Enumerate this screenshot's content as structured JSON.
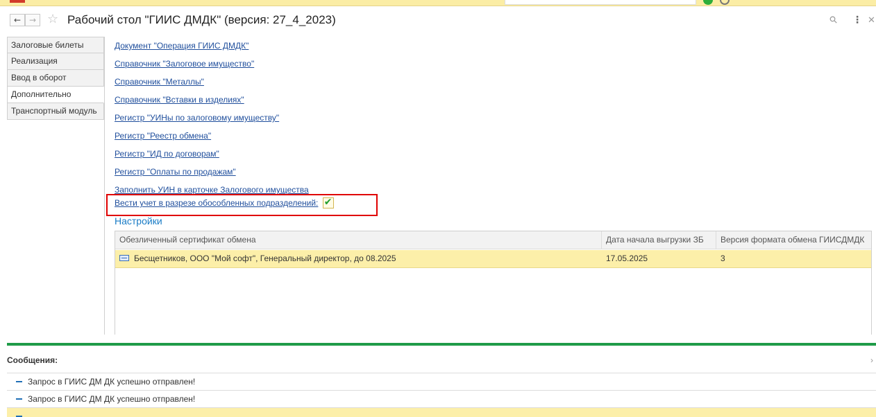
{
  "window": {
    "title": "Рабочий стол \"ГИИС ДМДК\" (версия: 27_4_2023)"
  },
  "icons": {
    "back": "arrow-left-icon",
    "forward": "arrow-right-icon",
    "favorite": "star-icon",
    "link": "link-icon",
    "more": "more-icon",
    "close": "close-icon",
    "certificate": "certificate-icon",
    "message": "dash-icon"
  },
  "colors": {
    "link": "#1f4e9c",
    "accent_green": "#1f9b48",
    "selection": "#fcefa9",
    "highlight_frame": "#e00000",
    "section_title": "#1a7cc6"
  },
  "sidebar": {
    "tabs": [
      {
        "label": "Залоговые билеты",
        "active": false
      },
      {
        "label": "Реализация",
        "active": false
      },
      {
        "label": "Ввод в оборот",
        "active": false
      },
      {
        "label": "Дополнительно",
        "active": true
      },
      {
        "label": "Транспортный модуль",
        "active": false
      }
    ]
  },
  "main": {
    "links": [
      "Документ \"Операция ГИИС ДМДК\"",
      "Справочник \"Залоговое имущество\"",
      "Справочник \"Металлы\"",
      "Справочник \"Вставки в изделиях\"",
      "Регистр \"УИНы по залоговому имуществу\"",
      "Регистр \"Реестр обмена\"",
      "Регистр \"ИД по договорам\"",
      "Регистр \"Оплаты по продажам\"",
      "Заполнить УИН в карточке Залогового имущества"
    ],
    "checkbox": {
      "label": "Вести учет в разрезе обособленных подразделений:",
      "checked": true
    },
    "settings": {
      "title": "Настройки",
      "columns": [
        "Обезличенный сертификат обмена",
        "Дата начала выгрузки ЗБ",
        "Версия формата обмена ГИИСДМДК"
      ],
      "rows": [
        [
          "Бесщетников, ООО \"Мой софт\", Генеральный директор, до 08.2025",
          "17.05.2025",
          "3"
        ]
      ]
    }
  },
  "messages": {
    "title": "Сообщения:",
    "items": [
      {
        "text": "Запрос в ГИИС ДМ ДК успешно отправлен!",
        "selected": false
      },
      {
        "text": "Запрос в ГИИС ДМ ДК успешно отправлен!",
        "selected": false
      },
      {
        "text": "",
        "selected": true
      }
    ]
  }
}
